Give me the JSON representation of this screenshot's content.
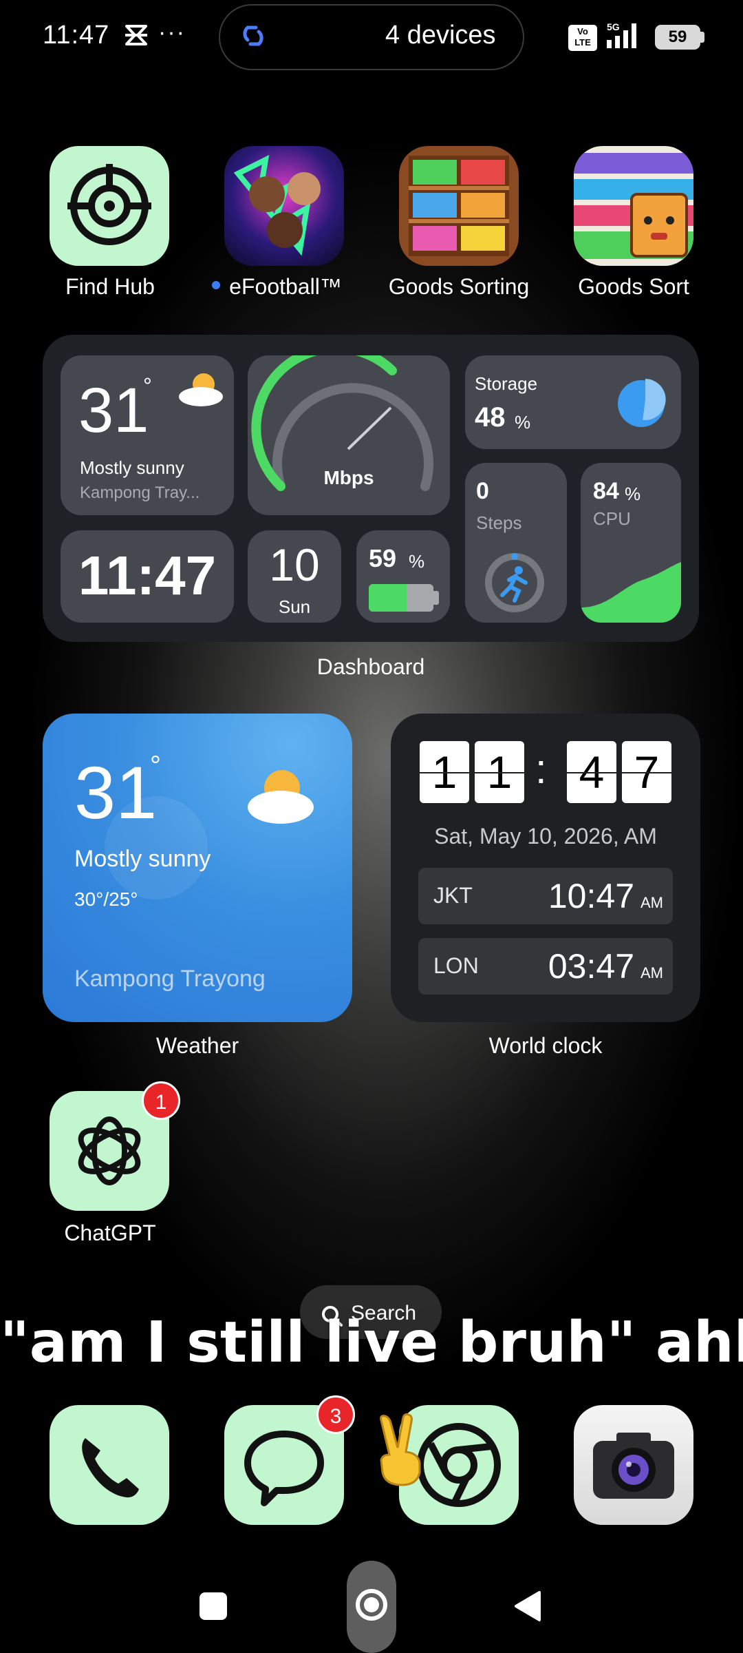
{
  "status_bar": {
    "time": "11:47",
    "more": "···",
    "island_text": "4 devices",
    "volte": "Vo LTE",
    "network": "5G",
    "battery": "59"
  },
  "apps_row1": [
    {
      "label": "Find Hub",
      "icon": "find-hub-icon"
    },
    {
      "label": "eFootball™",
      "icon": "efootball-icon",
      "new_dot": true
    },
    {
      "label": "Goods Sorting",
      "icon": "goods-sorting-icon"
    },
    {
      "label": "Goods Sort",
      "icon": "goods-sort-icon"
    }
  ],
  "dashboard": {
    "label": "Dashboard",
    "weather_temp": "31",
    "weather_deg": "°",
    "weather_cond": "Mostly sunny",
    "weather_loc": "Kampong Tray...",
    "speed_unit": "Mbps",
    "storage_label": "Storage",
    "storage_value": "48",
    "storage_unit": "%",
    "storage_fraction": 0.48,
    "clock": "11:47",
    "day_num": "10",
    "day_name": "Sun",
    "battery_value": "59",
    "battery_unit": "%",
    "battery_fraction": 0.59,
    "steps_value": "0",
    "steps_label": "Steps",
    "cpu_value": "84",
    "cpu_unit": "%",
    "cpu_label": "CPU"
  },
  "weather_widget": {
    "label": "Weather",
    "temp": "31",
    "deg": "°",
    "cond": "Mostly sunny",
    "range": "30°/25°",
    "location": "Kampong Trayong"
  },
  "world_clock": {
    "label": "World clock",
    "digits": [
      "1",
      "1",
      "4",
      "7"
    ],
    "colon": ":",
    "date": "Sat, May 10, 2026, AM",
    "zones": [
      {
        "city": "JKT",
        "time": "10:47",
        "ampm": "AM"
      },
      {
        "city": "LON",
        "time": "03:47",
        "ampm": "AM"
      }
    ]
  },
  "chatgpt": {
    "label": "ChatGPT",
    "badge": "1"
  },
  "search": {
    "label": "Search"
  },
  "caption": "\"am I still live bruh\" ahh",
  "dock": [
    {
      "name": "phone",
      "icon": "phone-icon"
    },
    {
      "name": "messages",
      "icon": "messages-icon",
      "badge": "3"
    },
    {
      "name": "chrome",
      "icon": "chrome-icon"
    },
    {
      "name": "camera",
      "icon": "camera-icon"
    }
  ],
  "colors": {
    "app_bg": "#c2f6cf",
    "accent_green": "#4cd964",
    "badge_red": "#e8262a",
    "weather_blue": "#2b79d7"
  }
}
